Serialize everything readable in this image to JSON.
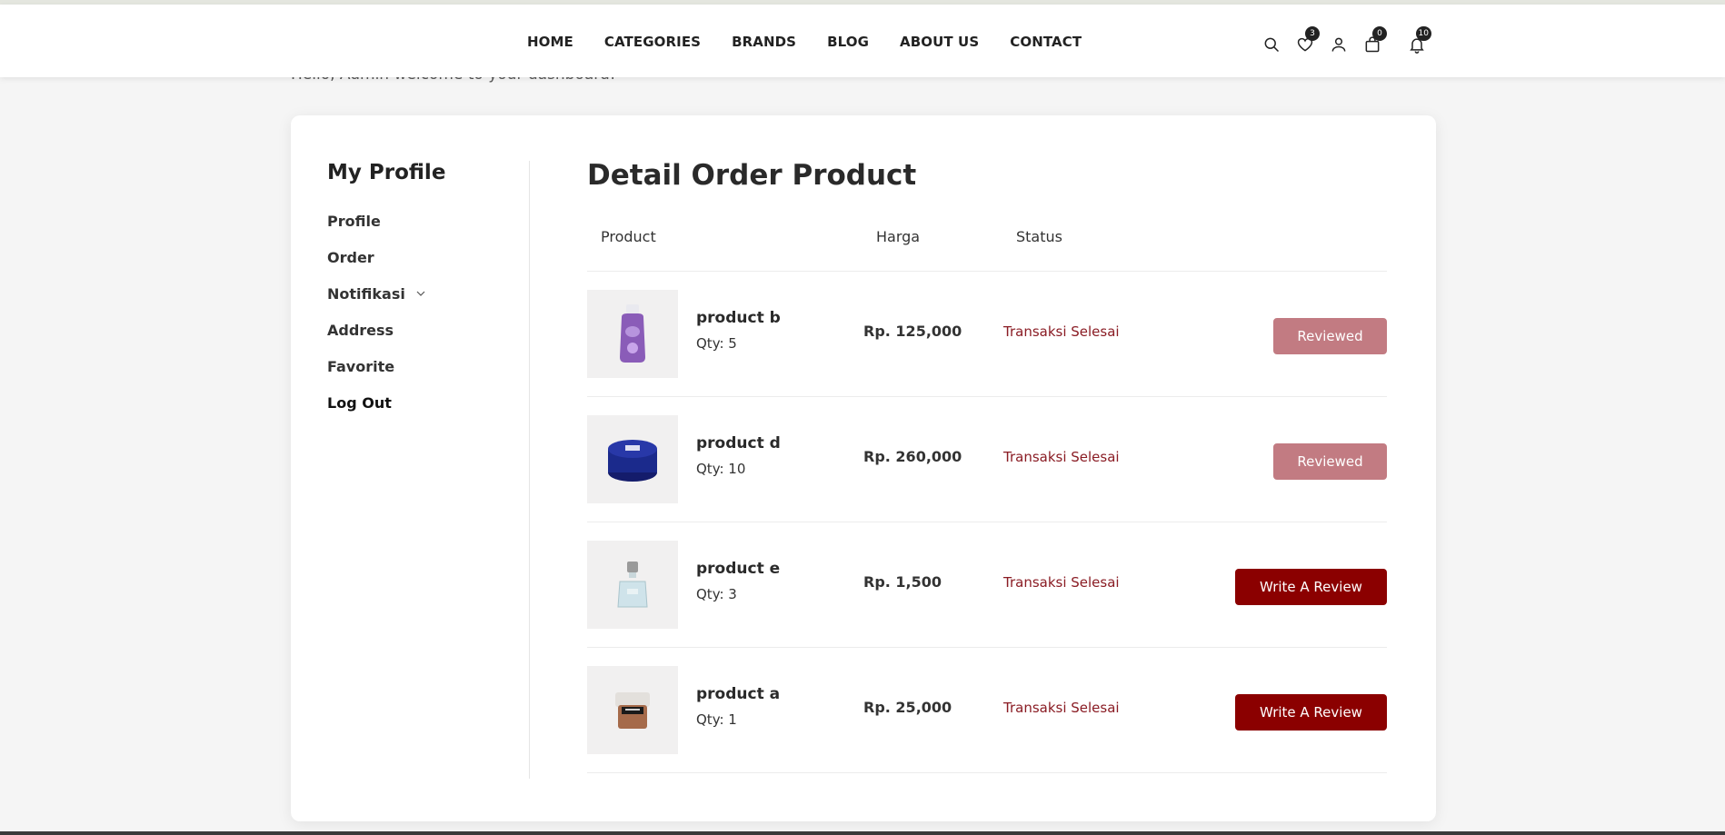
{
  "header": {
    "nav": [
      "HOME",
      "CATEGORIES",
      "BRANDS",
      "BLOG",
      "ABOUT US",
      "CONTACT"
    ],
    "badges": {
      "favorites": "3",
      "cart": "0",
      "notifications": "10"
    }
  },
  "welcome_text": "Hello, Admin welcome to your dashboard!",
  "sidebar": {
    "title": "My Profile",
    "items": [
      "Profile",
      "Order",
      "Notifikasi",
      "Address",
      "Favorite",
      "Log Out"
    ]
  },
  "main": {
    "title": "Detail Order Product",
    "columns": {
      "product": "Product",
      "harga": "Harga",
      "status": "Status"
    },
    "rows": [
      {
        "name": "product b",
        "qty": "Qty: 5",
        "price": "Rp. 125,000",
        "status": "Transaksi Selesai",
        "action": "Reviewed",
        "image": "purple-bottle"
      },
      {
        "name": "product d",
        "qty": "Qty: 10",
        "price": "Rp. 260,000",
        "status": "Transaksi Selesai",
        "action": "Reviewed",
        "image": "blue-tin"
      },
      {
        "name": "product e",
        "qty": "Qty: 3",
        "price": "Rp. 1,500",
        "status": "Transaksi Selesai",
        "action": "Write A Review",
        "image": "perfume-bottle"
      },
      {
        "name": "product a",
        "qty": "Qty: 1",
        "price": "Rp. 25,000",
        "status": "Transaksi Selesai",
        "action": "Write A Review",
        "image": "cream-jar"
      }
    ]
  },
  "colors": {
    "accent": "#8b0000",
    "reviewed": "#c27b82",
    "status_text": "#8a1c24"
  }
}
